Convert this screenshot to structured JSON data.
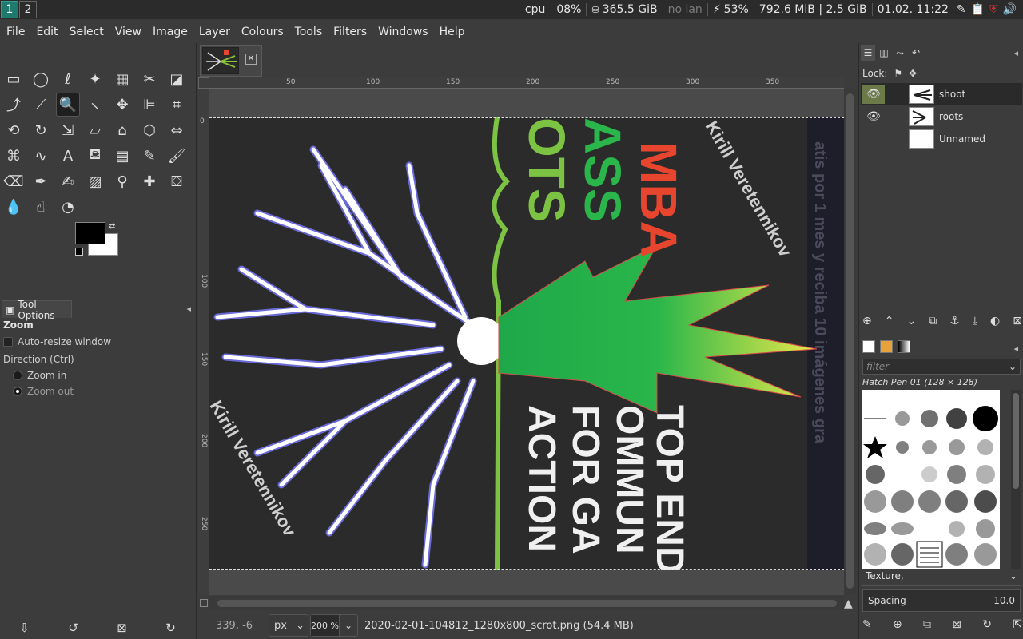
{
  "sysbar": {
    "workspaces": [
      "1",
      "2"
    ],
    "cpu_label": "cpu",
    "cpu_value": "08%",
    "disk": "365.5 GiB",
    "network": "no lan",
    "battery": "53%",
    "memory": "792.6 MiB | 2.5 GiB",
    "datetime": "01.02. 11:22"
  },
  "menu": [
    "File",
    "Edit",
    "Select",
    "View",
    "Image",
    "Layer",
    "Colours",
    "Tools",
    "Filters",
    "Windows",
    "Help"
  ],
  "tool_options": {
    "tab_label": "Tool Options",
    "title": "Zoom",
    "auto_resize": "Auto-resize window",
    "direction_label": "Direction  (Ctrl)",
    "zoom_in": "Zoom in",
    "zoom_out": "Zoom out"
  },
  "ruler": {
    "top_ticks": [
      "50",
      "100",
      "150",
      "200",
      "250",
      "300",
      "350"
    ],
    "left_ticks": [
      "0",
      "100",
      "150",
      "200",
      "250"
    ]
  },
  "status": {
    "coords": "339, -6",
    "unit": "px",
    "zoom": "200 %",
    "file": "2020-02-01-104812_1280x800_scrot.png (54.4 MB)"
  },
  "layers": {
    "lock_label": "Lock:",
    "items": [
      {
        "name": "shoot",
        "visible": true
      },
      {
        "name": "roots",
        "visible": true
      },
      {
        "name": "Unnamed",
        "visible": false
      }
    ]
  },
  "brushes": {
    "filter_placeholder": "filter",
    "selected": "Hatch Pen 01 (128 × 128)",
    "tag": "Texture,",
    "spacing_label": "Spacing",
    "spacing_value": "10.0"
  },
  "artwork": {
    "text_top_red": "MBA",
    "text_top_green_1": "ASS",
    "text_top_green_2": "OTS",
    "text_right_vertical": "Kirill Veretennikov",
    "text_left_vertical": "Kirill Veretennikov",
    "text_bottom_lines": [
      "TOP END",
      "OMMUN",
      "FOR GA",
      "ACTION"
    ],
    "text_far_right": "atis por 1 mes y reciba 10 imágenes gra"
  },
  "colors": {
    "accent_ws": "#1f7a6e",
    "leaf_green": "#2aa84a",
    "root_blue": "#6a6ad8",
    "red_text": "#e8452e",
    "green_text": "#7cc243"
  }
}
